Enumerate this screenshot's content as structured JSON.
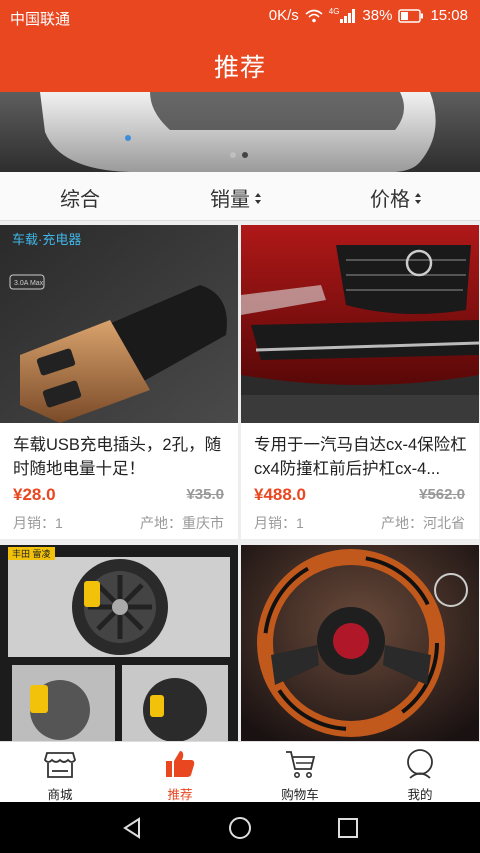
{
  "status": {
    "carrier": "中国联通",
    "speed": "0K/s",
    "network": "4G",
    "battery": "38%",
    "time": "15:08"
  },
  "header": {
    "title": "推荐"
  },
  "filters": [
    {
      "label": "综合",
      "sortable": false
    },
    {
      "label": "销量",
      "sortable": true
    },
    {
      "label": "价格",
      "sortable": true
    }
  ],
  "products": [
    {
      "image": "car-charger-image",
      "image_text": "车载·充电器",
      "title": "车载USB充电插头，2孔，随时随地电量十足！",
      "price": "¥28.0",
      "original_price": "¥35.0",
      "sales": "月销：1",
      "origin": "产地：重庆市"
    },
    {
      "image": "red-suv-front-image",
      "title": "专用于一汽马自达cx-4保险杠cx4防撞杠前后护杠cx-4...",
      "price": "¥488.0",
      "original_price": "¥562.0",
      "sales": "月销：1",
      "origin": "产地：河北省"
    },
    {
      "image": "wheel-brake-image",
      "image_text": "丰田 雷凌"
    },
    {
      "image": "steering-wheel-image"
    }
  ],
  "tabs": [
    {
      "label": "商城",
      "icon": "store-icon",
      "active": false
    },
    {
      "label": "推荐",
      "icon": "thumbs-up-icon",
      "active": true
    },
    {
      "label": "购物车",
      "icon": "cart-icon",
      "active": false
    },
    {
      "label": "我的",
      "icon": "user-icon",
      "active": false
    }
  ],
  "colors": {
    "accent": "#e8471f",
    "price": "#e8471f",
    "muted": "#999999"
  }
}
